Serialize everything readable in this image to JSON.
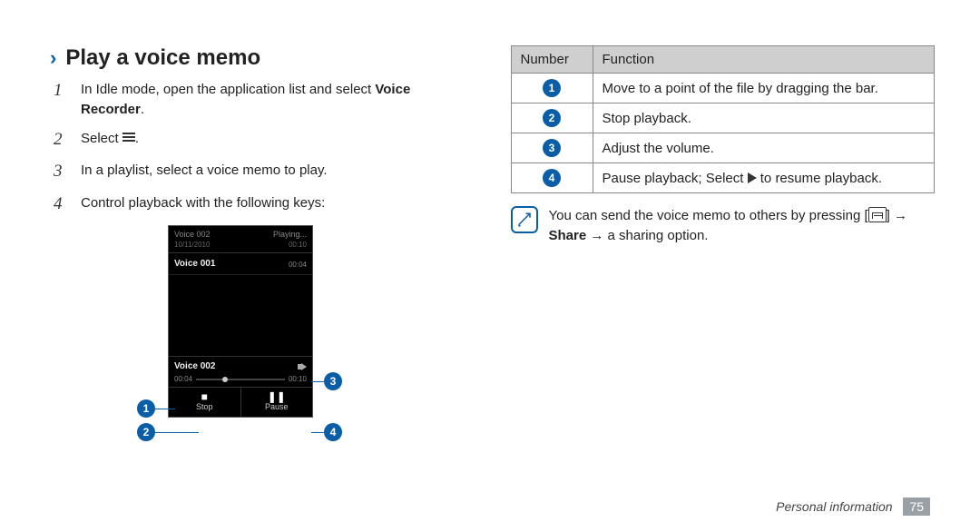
{
  "heading": "Play a voice memo",
  "steps": [
    {
      "num": "1",
      "pre": "In Idle mode, open the application list and select ",
      "bold": "Voice Recorder",
      "post": "."
    },
    {
      "num": "2",
      "pre": "Select ",
      "icon": "list-icon",
      "post": "."
    },
    {
      "num": "3",
      "pre": "In a playlist, select a voice memo to play."
    },
    {
      "num": "4",
      "pre": "Control playback with the following keys:"
    }
  ],
  "phone": {
    "header_title": "Voice 002",
    "header_status": "Playing...",
    "header_date": "10/11/2010",
    "header_dur": "00:10",
    "item_title": "Voice 001",
    "item_dur": "00:04",
    "now_title": "Voice 002",
    "seek_left": "00:04",
    "seek_right": "00:10",
    "btn_stop": "Stop",
    "btn_pause": "Pause"
  },
  "callouts": {
    "c1": "1",
    "c2": "2",
    "c3": "3",
    "c4": "4"
  },
  "table": {
    "h_num": "Number",
    "h_func": "Function",
    "rows": [
      {
        "n": "1",
        "f": "Move to a point of the file by dragging the bar."
      },
      {
        "n": "2",
        "f": "Stop playback."
      },
      {
        "n": "3",
        "f": "Adjust the volume."
      },
      {
        "n": "4",
        "f_pre": "Pause playback; Select ",
        "f_post": " to resume playback."
      }
    ]
  },
  "note": {
    "line1": "You can send the voice memo to others by pressing",
    "arrow": " → ",
    "share": "Share",
    "line2_post": " → a sharing option."
  },
  "footer": {
    "section": "Personal information",
    "page": "75"
  }
}
